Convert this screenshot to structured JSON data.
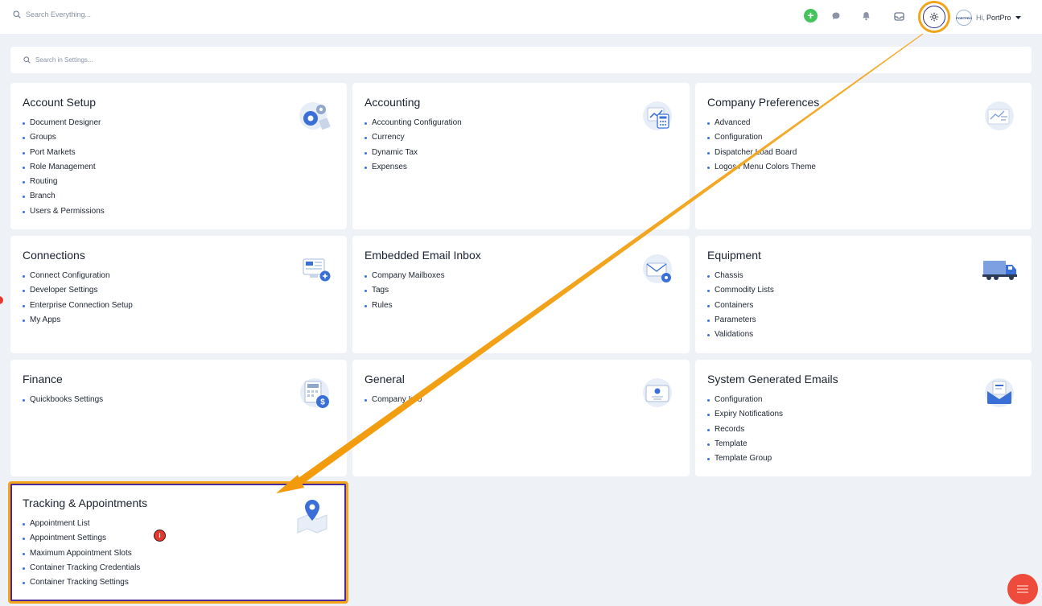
{
  "top_bar": {
    "search_placeholder": "Search Everything...",
    "user_greeting": "Hi,",
    "user_name": "PortPro",
    "user_logo_text": "PORTPRO"
  },
  "settings_search": {
    "placeholder": "Search in Settings..."
  },
  "cards": {
    "account_setup": {
      "title": "Account Setup",
      "items": [
        "Document Designer",
        "Groups",
        "Port Markets",
        "Role Management",
        "Routing",
        "Branch",
        "Users & Permissions"
      ]
    },
    "accounting": {
      "title": "Accounting",
      "items": [
        "Accounting Configuration",
        "Currency",
        "Dynamic Tax",
        "Expenses"
      ]
    },
    "company_preferences": {
      "title": "Company Preferences",
      "items": [
        "Advanced",
        "Configuration",
        "Dispatcher Load Board",
        "Logos / Menu Colors Theme"
      ]
    },
    "connections": {
      "title": "Connections",
      "items": [
        "Connect Configuration",
        "Developer Settings",
        "Enterprise Connection Setup",
        "My Apps"
      ]
    },
    "embedded_email_inbox": {
      "title": "Embedded Email Inbox",
      "items": [
        "Company Mailboxes",
        "Tags",
        "Rules"
      ]
    },
    "equipment": {
      "title": "Equipment",
      "items": [
        "Chassis",
        "Commodity Lists",
        "Containers",
        "Parameters",
        "Validations"
      ]
    },
    "finance": {
      "title": "Finance",
      "items": [
        "Quickbooks Settings"
      ]
    },
    "general": {
      "title": "General",
      "items": [
        "Company Info"
      ]
    },
    "system_generated_emails": {
      "title": "System Generated Emails",
      "items": [
        "Configuration",
        "Expiry Notifications",
        "Records",
        "Template",
        "Template Group"
      ]
    },
    "tracking_appointments": {
      "title": "Tracking & Appointments",
      "items": [
        "Appointment List",
        "Appointment Settings",
        "Maximum Appointment Slots",
        "Container Tracking Credentials",
        "Container Tracking Settings"
      ]
    }
  },
  "annotation": {
    "info_badge": "i"
  },
  "colors": {
    "accent": "#3a6ee8",
    "highlight": "#f2a51a",
    "add_button": "#45c35c",
    "fab": "#ef4b3c"
  }
}
